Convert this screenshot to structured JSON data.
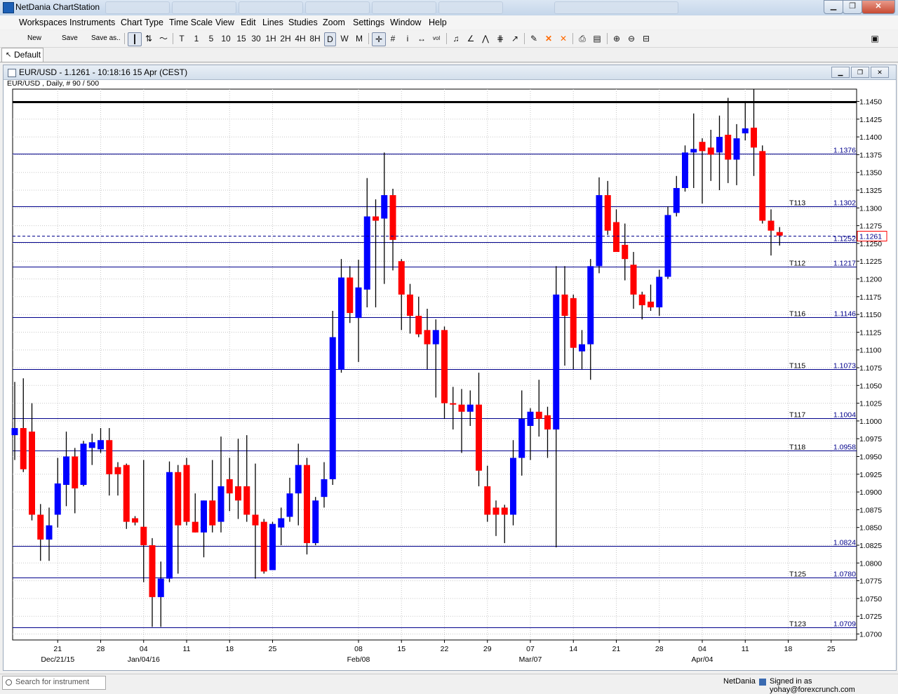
{
  "app": {
    "title": "NetDania ChartStation"
  },
  "menu": [
    "Workspaces",
    "Instruments",
    "Chart Type",
    "Time Scale",
    "View",
    "Edit",
    "Lines",
    "Studies",
    "Zoom",
    "Settings",
    "Window",
    "Help"
  ],
  "toolbar": {
    "new_label": "New",
    "save_label": "Save",
    "save_as_label": "Save as..",
    "timeframes": [
      "T",
      "1",
      "5",
      "10",
      "15",
      "30",
      "1H",
      "2H",
      "4H",
      "8H",
      "D",
      "W",
      "M"
    ],
    "selected_timeframe": "D"
  },
  "workspace_tab": {
    "label": "Default"
  },
  "chart_window": {
    "title": "EUR/USD - 1.1261 - 10:18:16  15 Apr (CEST)",
    "subtitle": "EUR/USD , Daily, # 90 / 500"
  },
  "chart_data": {
    "type": "candlestick",
    "instrument": "EUR/USD",
    "period": "Daily",
    "ylim": [
      1.069,
      1.147
    ],
    "y_ticks": [
      "1.0700",
      "1.0725",
      "1.0750",
      "1.0775",
      "1.0800",
      "1.0825",
      "1.0850",
      "1.0875",
      "1.0900",
      "1.0925",
      "1.0950",
      "1.0975",
      "1.1000",
      "1.1025",
      "1.1050",
      "1.1075",
      "1.1100",
      "1.1125",
      "1.1150",
      "1.1175",
      "1.1200",
      "1.1225",
      "1.1250",
      "1.1275",
      "1.1300",
      "1.1325",
      "1.1350",
      "1.1375",
      "1.1400",
      "1.1425",
      "1.1450"
    ],
    "x_ticks": [
      {
        "label": "21",
        "sub": "Dec/21/15",
        "i": 5
      },
      {
        "label": "28",
        "sub": "",
        "i": 10
      },
      {
        "label": "04",
        "sub": "Jan/04/16",
        "i": 15
      },
      {
        "label": "11",
        "sub": "",
        "i": 20
      },
      {
        "label": "18",
        "sub": "",
        "i": 25
      },
      {
        "label": "25",
        "sub": "",
        "i": 30
      },
      {
        "label": "08",
        "sub": "Feb/08",
        "i": 40
      },
      {
        "label": "15",
        "sub": "",
        "i": 45
      },
      {
        "label": "22",
        "sub": "",
        "i": 50
      },
      {
        "label": "29",
        "sub": "",
        "i": 55
      },
      {
        "label": "07",
        "sub": "Mar/07",
        "i": 60
      },
      {
        "label": "14",
        "sub": "",
        "i": 65
      },
      {
        "label": "21",
        "sub": "",
        "i": 70
      },
      {
        "label": "28",
        "sub": "",
        "i": 75
      },
      {
        "label": "04",
        "sub": "Apr/04",
        "i": 80
      },
      {
        "label": "11",
        "sub": "",
        "i": 85
      },
      {
        "label": "18",
        "sub": "",
        "i": 90
      },
      {
        "label": "25",
        "sub": "",
        "i": 95
      }
    ],
    "bull_color": "#0000ff",
    "bear_color": "#ff0000",
    "candles": [
      {
        "o": 1.098,
        "h": 1.1055,
        "l": 1.0945,
        "c": 1.099
      },
      {
        "o": 1.099,
        "h": 1.106,
        "l": 1.0928,
        "c": 1.0932
      },
      {
        "o": 1.0985,
        "h": 1.1025,
        "l": 1.086,
        "c": 1.0868
      },
      {
        "o": 1.0868,
        "h": 1.0883,
        "l": 1.0803,
        "c": 1.0833
      },
      {
        "o": 1.0833,
        "h": 1.0878,
        "l": 1.0803,
        "c": 1.0853
      },
      {
        "o": 1.0868,
        "h": 1.0948,
        "l": 1.085,
        "c": 1.0912
      },
      {
        "o": 1.091,
        "h": 1.0985,
        "l": 1.088,
        "c": 1.095
      },
      {
        "o": 1.095,
        "h": 1.0962,
        "l": 1.087,
        "c": 1.0905
      },
      {
        "o": 1.091,
        "h": 1.0972,
        "l": 1.0908,
        "c": 1.0968
      },
      {
        "o": 1.0962,
        "h": 1.0982,
        "l": 1.0938,
        "c": 1.097
      },
      {
        "o": 1.096,
        "h": 1.099,
        "l": 1.0955,
        "c": 1.0973
      },
      {
        "o": 1.0973,
        "h": 1.099,
        "l": 1.0895,
        "c": 1.0925
      },
      {
        "o": 1.0935,
        "h": 1.0942,
        "l": 1.0895,
        "c": 1.0925
      },
      {
        "o": 1.0938,
        "h": 1.094,
        "l": 1.0848,
        "c": 1.0858
      },
      {
        "o": 1.0863,
        "h": 1.0866,
        "l": 1.0853,
        "c": 1.0857
      },
      {
        "o": 1.0851,
        "h": 1.0945,
        "l": 1.0773,
        "c": 1.0825
      },
      {
        "o": 1.0825,
        "h": 1.0835,
        "l": 1.071,
        "c": 1.0752
      },
      {
        "o": 1.0752,
        "h": 1.0802,
        "l": 1.071,
        "c": 1.0778
      },
      {
        "o": 1.0778,
        "h": 1.0943,
        "l": 1.0773,
        "c": 1.0928
      },
      {
        "o": 1.0928,
        "h": 1.0938,
        "l": 1.0785,
        "c": 1.0853
      },
      {
        "o": 1.0938,
        "h": 1.0948,
        "l": 1.0853,
        "c": 1.0858
      },
      {
        "o": 1.0858,
        "h": 1.0898,
        "l": 1.0843,
        "c": 1.0843
      },
      {
        "o": 1.0843,
        "h": 1.0888,
        "l": 1.0808,
        "c": 1.0888
      },
      {
        "o": 1.0888,
        "h": 1.0945,
        "l": 1.0843,
        "c": 1.0853
      },
      {
        "o": 1.0858,
        "h": 1.0978,
        "l": 1.0843,
        "c": 1.0908
      },
      {
        "o": 1.0918,
        "h": 1.0948,
        "l": 1.0873,
        "c": 1.0898
      },
      {
        "o": 1.0908,
        "h": 1.0975,
        "l": 1.0862,
        "c": 1.0888
      },
      {
        "o": 1.0908,
        "h": 1.098,
        "l": 1.0858,
        "c": 1.0868
      },
      {
        "o": 1.0868,
        "h": 1.094,
        "l": 1.0778,
        "c": 1.0853
      },
      {
        "o": 1.0858,
        "h": 1.0862,
        "l": 1.0785,
        "c": 1.0788
      },
      {
        "o": 1.079,
        "h": 1.0858,
        "l": 1.079,
        "c": 1.0855
      },
      {
        "o": 1.085,
        "h": 1.0878,
        "l": 1.0825,
        "c": 1.0863
      },
      {
        "o": 1.0865,
        "h": 1.092,
        "l": 1.0858,
        "c": 1.0898
      },
      {
        "o": 1.0898,
        "h": 1.0968,
        "l": 1.0853,
        "c": 1.0938
      },
      {
        "o": 1.0938,
        "h": 1.0948,
        "l": 1.0812,
        "c": 1.0828
      },
      {
        "o": 1.0828,
        "h": 1.0893,
        "l": 1.0825,
        "c": 1.0888
      },
      {
        "o": 1.0893,
        "h": 1.0942,
        "l": 1.0878,
        "c": 1.0918
      },
      {
        "o": 1.0918,
        "h": 1.1155,
        "l": 1.091,
        "c": 1.1118
      },
      {
        "o": 1.1072,
        "h": 1.1228,
        "l": 1.1068,
        "c": 1.1202
      },
      {
        "o": 1.1202,
        "h": 1.1218,
        "l": 1.1138,
        "c": 1.1152
      },
      {
        "o": 1.1145,
        "h": 1.1227,
        "l": 1.1083,
        "c": 1.1188
      },
      {
        "o": 1.1185,
        "h": 1.1342,
        "l": 1.116,
        "c": 1.1288
      },
      {
        "o": 1.1288,
        "h": 1.1312,
        "l": 1.116,
        "c": 1.1282
      },
      {
        "o": 1.1285,
        "h": 1.1378,
        "l": 1.1193,
        "c": 1.1318
      },
      {
        "o": 1.1318,
        "h": 1.1327,
        "l": 1.1212,
        "c": 1.1255
      },
      {
        "o": 1.1225,
        "h": 1.1228,
        "l": 1.1128,
        "c": 1.1178
      },
      {
        "o": 1.1178,
        "h": 1.1193,
        "l": 1.1123,
        "c": 1.1148
      },
      {
        "o": 1.1148,
        "h": 1.1175,
        "l": 1.1118,
        "c": 1.1122
      },
      {
        "o": 1.1128,
        "h": 1.1158,
        "l": 1.1073,
        "c": 1.1108
      },
      {
        "o": 1.1108,
        "h": 1.1143,
        "l": 1.1033,
        "c": 1.1128
      },
      {
        "o": 1.1128,
        "h": 1.1133,
        "l": 1.1003,
        "c": 1.1025
      },
      {
        "o": 1.1025,
        "h": 1.1048,
        "l": 1.0988,
        "c": 1.1023
      },
      {
        "o": 1.1023,
        "h": 1.1045,
        "l": 1.0955,
        "c": 1.1013
      },
      {
        "o": 1.1013,
        "h": 1.1043,
        "l": 1.0993,
        "c": 1.1023
      },
      {
        "o": 1.1023,
        "h": 1.1068,
        "l": 1.0908,
        "c": 1.093
      },
      {
        "o": 1.0908,
        "h": 1.0937,
        "l": 1.0858,
        "c": 1.0868
      },
      {
        "o": 1.0878,
        "h": 1.0888,
        "l": 1.0838,
        "c": 1.0868
      },
      {
        "o": 1.0878,
        "h": 1.0882,
        "l": 1.0828,
        "c": 1.0868
      },
      {
        "o": 1.0868,
        "h": 1.0973,
        "l": 1.0853,
        "c": 1.0948
      },
      {
        "o": 1.0948,
        "h": 1.1043,
        "l": 1.0923,
        "c": 1.1003
      },
      {
        "o": 1.0993,
        "h": 1.1018,
        "l": 1.0945,
        "c": 1.1013
      },
      {
        "o": 1.1013,
        "h": 1.1058,
        "l": 1.0978,
        "c": 1.1003
      },
      {
        "o": 1.1008,
        "h": 1.102,
        "l": 1.0948,
        "c": 1.0988
      },
      {
        "o": 1.0988,
        "h": 1.1218,
        "l": 1.0822,
        "c": 1.1178
      },
      {
        "o": 1.1178,
        "h": 1.1218,
        "l": 1.1078,
        "c": 1.1148
      },
      {
        "o": 1.1173,
        "h": 1.1178,
        "l": 1.1073,
        "c": 1.1103
      },
      {
        "o": 1.1098,
        "h": 1.1128,
        "l": 1.1073,
        "c": 1.1108
      },
      {
        "o": 1.1108,
        "h": 1.1228,
        "l": 1.1058,
        "c": 1.1218
      },
      {
        "o": 1.1218,
        "h": 1.1343,
        "l": 1.1208,
        "c": 1.1318
      },
      {
        "o": 1.1318,
        "h": 1.1338,
        "l": 1.1262,
        "c": 1.1268
      },
      {
        "o": 1.128,
        "h": 1.1298,
        "l": 1.1238,
        "c": 1.1238
      },
      {
        "o": 1.1248,
        "h": 1.1278,
        "l": 1.1198,
        "c": 1.1228
      },
      {
        "o": 1.122,
        "h": 1.1238,
        "l": 1.1158,
        "c": 1.1178
      },
      {
        "o": 1.1178,
        "h": 1.1182,
        "l": 1.1143,
        "c": 1.1163
      },
      {
        "o": 1.1168,
        "h": 1.1192,
        "l": 1.1155,
        "c": 1.116
      },
      {
        "o": 1.116,
        "h": 1.1213,
        "l": 1.1148,
        "c": 1.1203
      },
      {
        "o": 1.1203,
        "h": 1.1302,
        "l": 1.12,
        "c": 1.129
      },
      {
        "o": 1.1293,
        "h": 1.1345,
        "l": 1.1288,
        "c": 1.1328
      },
      {
        "o": 1.1328,
        "h": 1.1388,
        "l": 1.1323,
        "c": 1.1378
      },
      {
        "o": 1.1378,
        "h": 1.1433,
        "l": 1.1328,
        "c": 1.1383
      },
      {
        "o": 1.1393,
        "h": 1.1398,
        "l": 1.1306,
        "c": 1.138
      },
      {
        "o": 1.1385,
        "h": 1.141,
        "l": 1.1338,
        "c": 1.1375
      },
      {
        "o": 1.1378,
        "h": 1.143,
        "l": 1.1325,
        "c": 1.14
      },
      {
        "o": 1.1403,
        "h": 1.1455,
        "l": 1.1335,
        "c": 1.1368
      },
      {
        "o": 1.1368,
        "h": 1.1418,
        "l": 1.1332,
        "c": 1.1398
      },
      {
        "o": 1.1405,
        "h": 1.1448,
        "l": 1.1395,
        "c": 1.1412
      },
      {
        "o": 1.1413,
        "h": 1.1467,
        "l": 1.1345,
        "c": 1.1385
      },
      {
        "o": 1.138,
        "h": 1.1388,
        "l": 1.1278,
        "c": 1.1282
      },
      {
        "o": 1.1282,
        "h": 1.1298,
        "l": 1.1233,
        "c": 1.1268
      },
      {
        "o": 1.1266,
        "h": 1.1273,
        "l": 1.1247,
        "c": 1.1261
      }
    ],
    "horizontal_lines": [
      {
        "y": 1.145,
        "label": "",
        "tag": "",
        "style": "thick-black"
      },
      {
        "y": 1.1376,
        "label": "1.1376",
        "tag": "",
        "style": "blue"
      },
      {
        "y": 1.1302,
        "label": "1.1302",
        "tag": "T113",
        "style": "blue"
      },
      {
        "y": 1.1252,
        "label": "1.1252",
        "tag": "",
        "style": "blue"
      },
      {
        "y": 1.1217,
        "label": "1.1217",
        "tag": "T112",
        "style": "blue"
      },
      {
        "y": 1.1146,
        "label": "1.1146",
        "tag": "T116",
        "style": "blue"
      },
      {
        "y": 1.1073,
        "label": "1.1073",
        "tag": "T115",
        "style": "blue"
      },
      {
        "y": 1.1004,
        "label": "1.1004",
        "tag": "T117",
        "style": "blue"
      },
      {
        "y": 1.0958,
        "label": "1.0958",
        "tag": "T118",
        "style": "blue"
      },
      {
        "y": 1.0824,
        "label": "1.0824",
        "tag": "",
        "style": "blue"
      },
      {
        "y": 1.078,
        "label": "1.0780",
        "tag": "T125",
        "style": "blue"
      },
      {
        "y": 1.0709,
        "label": "1.0709",
        "tag": "T123",
        "style": "blue"
      }
    ],
    "current_price": {
      "value": 1.1261,
      "label": "1.1261"
    }
  },
  "status": {
    "search_placeholder": "Search for instrument",
    "brand": "NetDania",
    "signed_in": "Signed in as yohay@forexcrunch.com"
  }
}
